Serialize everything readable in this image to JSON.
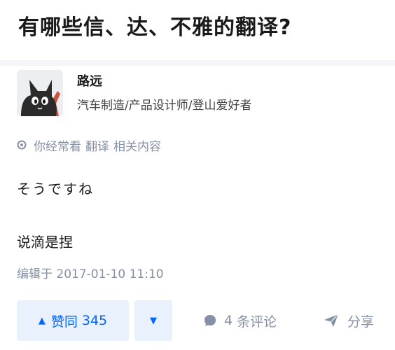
{
  "question": {
    "title": "有哪些信、达、不雅的翻译?"
  },
  "author": {
    "name": "路远",
    "bio": "汽车制造/产品设计师/登山爱好者",
    "avatar_icon": "black-cat-avatar"
  },
  "related_hint": {
    "prefix": "你经常看",
    "topic": "翻译",
    "suffix": "相关内容"
  },
  "answer": {
    "lines": [
      "そうですね",
      "说滴是捏"
    ],
    "edited": "编辑于 2017-01-10 11:10"
  },
  "actions": {
    "vote_up_label": "赞同",
    "vote_up_count": "345",
    "comment_count": "4",
    "comment_label": "条评论",
    "share_label": "分享"
  },
  "colors": {
    "accent": "#0066ff",
    "vote_bg": "#e8f1fc",
    "muted": "#8590a6"
  }
}
